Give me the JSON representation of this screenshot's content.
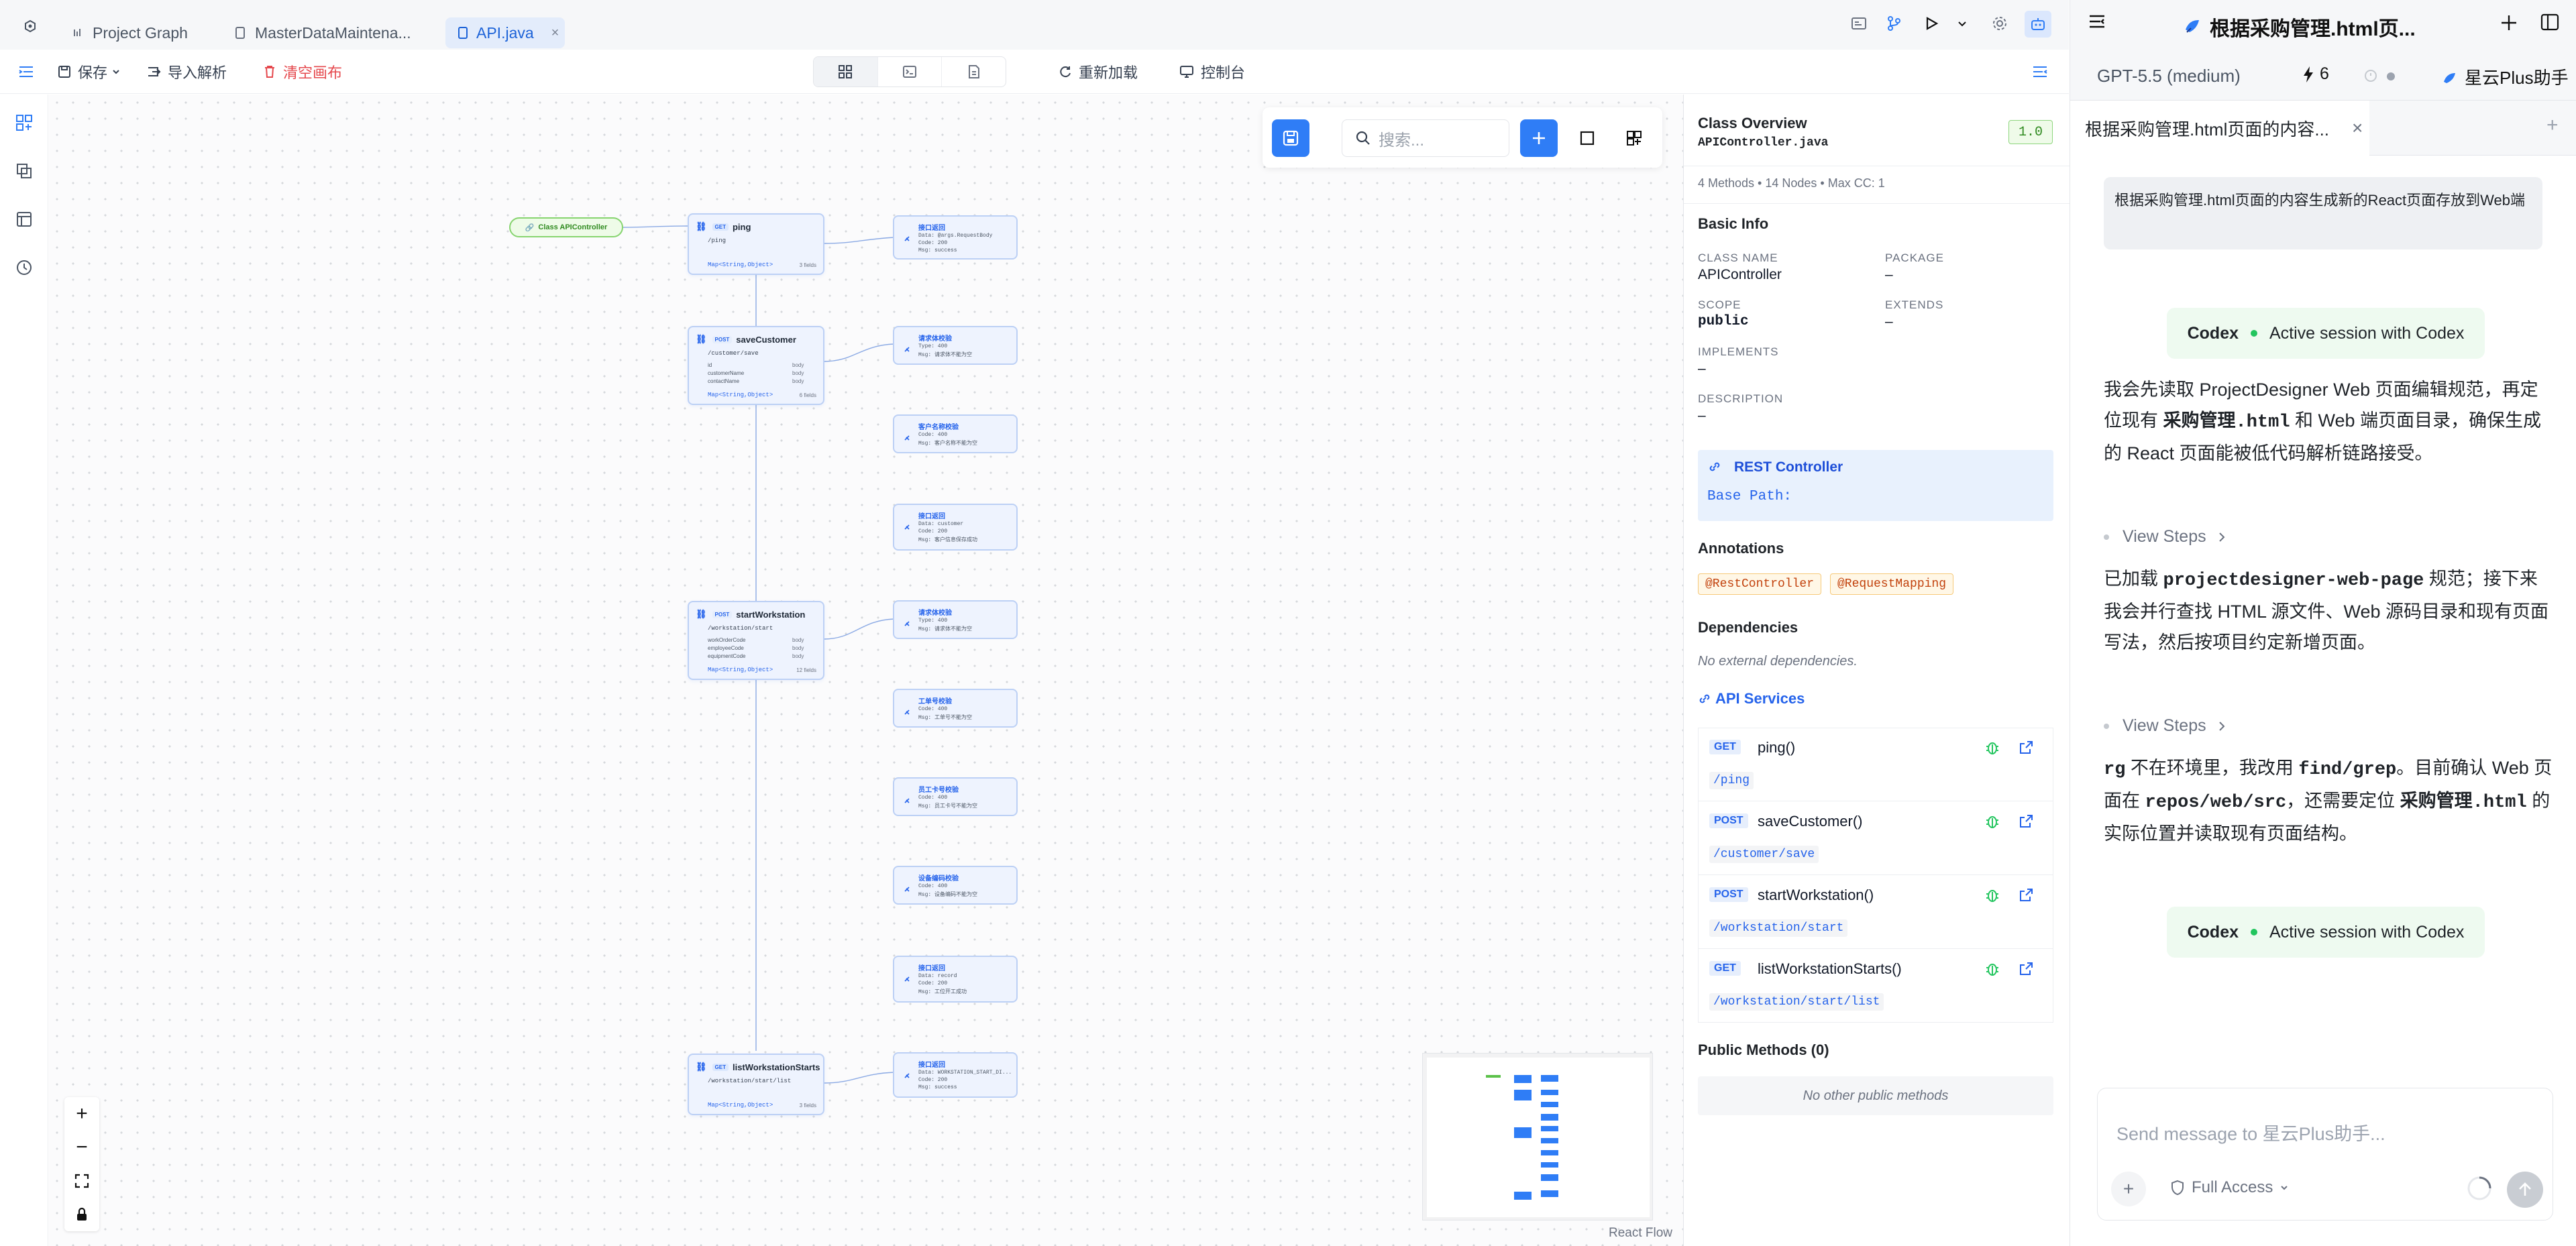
{
  "tabs": [
    {
      "label": "Project Graph",
      "active": false
    },
    {
      "label": "MasterDataMaintena...",
      "active": false
    },
    {
      "label": "API.java",
      "active": true
    }
  ],
  "toolbar": {
    "save": "保存",
    "import": "导入解析",
    "clear": "清空画布",
    "reload": "重新加载",
    "console": "控制台"
  },
  "canvas": {
    "search_placeholder": "搜索...",
    "class_node": "Class APIController",
    "attribution": "React Flow",
    "method_nodes": [
      {
        "method": "GET",
        "name": "ping",
        "path": "/ping",
        "returns": "Map<String,Object>",
        "count": "3 fields",
        "fields": []
      },
      {
        "method": "POST",
        "name": "saveCustomer",
        "path": "/customer/save",
        "returns": "Map<String,Object>",
        "count": "6 fields",
        "fields": [
          {
            "name": "id",
            "type": "body"
          },
          {
            "name": "customerName",
            "type": "body"
          },
          {
            "name": "contactName",
            "type": "body"
          }
        ]
      },
      {
        "method": "POST",
        "name": "startWorkstation",
        "path": "/workstation/start",
        "returns": "Map<String,Object>",
        "count": "12 fields",
        "fields": [
          {
            "name": "workOrderCode",
            "type": "body"
          },
          {
            "name": "employeeCode",
            "type": "body"
          },
          {
            "name": "equipmentCode",
            "type": "body"
          }
        ]
      },
      {
        "method": "GET",
        "name": "listWorkstationStarts",
        "path": "/workstation/start/list",
        "returns": "Map<String,Object>",
        "count": "3 fields",
        "fields": []
      }
    ],
    "result_nodes": [
      {
        "title": "接口返回",
        "lines": [
          "Data: @args.RequestBody",
          "Code: 200",
          "Msg: success"
        ]
      },
      {
        "title": "请求体校验",
        "lines": [
          "Type: 400",
          "Msg: 请求体不能为空"
        ]
      },
      {
        "title": "客户名称校验",
        "lines": [
          "Code: 400",
          "Msg: 客户名称不能为空"
        ]
      },
      {
        "title": "接口返回",
        "lines": [
          "Data: customer",
          "Code: 200",
          "Msg: 客户信息保存成功"
        ]
      },
      {
        "title": "请求体校验",
        "lines": [
          "Type: 400",
          "Msg: 请求体不能为空"
        ]
      },
      {
        "title": "工单号校验",
        "lines": [
          "Code: 400",
          "Msg: 工单号不能为空"
        ]
      },
      {
        "title": "员工卡号校验",
        "lines": [
          "Code: 400",
          "Msg: 员工卡号不能为空"
        ]
      },
      {
        "title": "设备编码校验",
        "lines": [
          "Code: 400",
          "Msg: 设备编码不能为空"
        ]
      },
      {
        "title": "接口返回",
        "lines": [
          "Data: record",
          "Code: 200",
          "Msg: 工位开工成功"
        ]
      },
      {
        "title": "接口返回",
        "lines": [
          "Data: WORKSTATION_START_DI...",
          "Code: 200",
          "Msg: success"
        ]
      }
    ]
  },
  "inspector": {
    "title": "Class Overview",
    "file": "APIController.java",
    "version": "1.0",
    "stats": "4 Methods  •  14 Nodes  •  Max CC: 1",
    "basic_info": "Basic Info",
    "class_name_label": "CLASS NAME",
    "class_name": "APIController",
    "package_label": "PACKAGE",
    "package": "–",
    "scope_label": "SCOPE",
    "scope": "public",
    "extends_label": "EXTENDS",
    "extends": "–",
    "implements_label": "IMPLEMENTS",
    "implements": "–",
    "description_label": "DESCRIPTION",
    "description": "–",
    "rest_title": "REST Controller",
    "rest_base": "Base Path:",
    "annotations_title": "Annotations",
    "annotations": [
      "@RestController",
      "@RequestMapping"
    ],
    "dependencies_title": "Dependencies",
    "dependencies_empty": "No external dependencies.",
    "services_title": "API Services",
    "services": [
      {
        "method": "GET",
        "name": "ping()",
        "path": "/ping"
      },
      {
        "method": "POST",
        "name": "saveCustomer()",
        "path": "/customer/save"
      },
      {
        "method": "POST",
        "name": "startWorkstation()",
        "path": "/workstation/start"
      },
      {
        "method": "GET",
        "name": "listWorkstationStarts()",
        "path": "/workstation/start/list"
      }
    ],
    "public_methods_title": "Public Methods (0)",
    "public_methods_empty": "No other public methods"
  },
  "chat": {
    "title": "根据采购管理.html页...",
    "model": "GPT-5.5 (medium)",
    "count": "6",
    "assistant": "星云Plus助手",
    "tab": "根据采购管理.html页面的内容...",
    "user_message": "根据采购管理.html页面的内容生成新的React页面存放到Web端",
    "session_name": "Codex",
    "session_status": "Active session with Codex",
    "view_steps": "View Steps",
    "placeholder": "Send message to 星云Plus助手...",
    "access": "Full Access"
  },
  "colors": {
    "accent": "#2f7df6",
    "danger": "#e5484d",
    "success": "#22c55e"
  }
}
